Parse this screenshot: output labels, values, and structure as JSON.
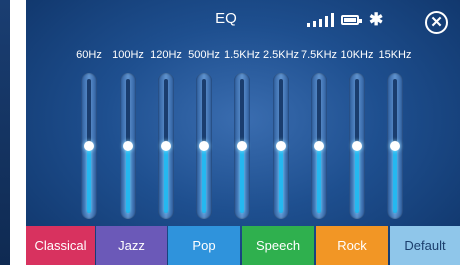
{
  "header": {
    "title": "EQ",
    "status_icons": [
      "signal-icon",
      "battery-icon",
      "bluetooth-icon"
    ],
    "bluetooth_glyph": "✱",
    "close_glyph": "✕"
  },
  "bands": [
    {
      "label": "60Hz",
      "level": 0.5
    },
    {
      "label": "100Hz",
      "level": 0.5
    },
    {
      "label": "120Hz",
      "level": 0.5
    },
    {
      "label": "500Hz",
      "level": 0.5
    },
    {
      "label": "1.5KHz",
      "level": 0.5
    },
    {
      "label": "2.5KHz",
      "level": 0.5
    },
    {
      "label": "7.5KHz",
      "level": 0.5
    },
    {
      "label": "10KHz",
      "level": 0.5
    },
    {
      "label": "15KHz",
      "level": 0.5
    }
  ],
  "presets": [
    {
      "label": "Classical",
      "color": "#d8325f"
    },
    {
      "label": "Jazz",
      "color": "#6b59b8"
    },
    {
      "label": "Pop",
      "color": "#2f93dc"
    },
    {
      "label": "Speech",
      "color": "#2fb04e"
    },
    {
      "label": "Rock",
      "color": "#f29625"
    },
    {
      "label": "Default",
      "color": "#8fc6ea",
      "text_color": "#1c3f6d"
    }
  ]
}
